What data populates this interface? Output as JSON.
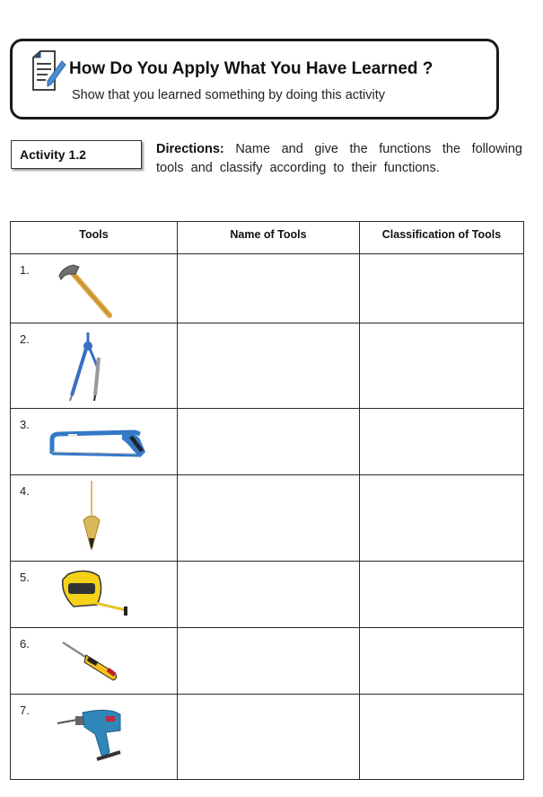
{
  "header": {
    "icon": "document-pencil-icon",
    "title": "How Do You Apply What You Have Learned ?",
    "subtitle": "Show that you learned something by doing this activity"
  },
  "activity": {
    "label": "Activity 1.2",
    "directions_label": "Directions:",
    "directions_text": "Name and give the functions the following tools  and classify according to their functions."
  },
  "table": {
    "columns": [
      "Tools",
      "Name of Tools",
      "Classification of Tools"
    ],
    "rows": [
      {
        "number": "1.",
        "tool_icon": "claw-hammer-icon",
        "name": "",
        "classification": ""
      },
      {
        "number": "2.",
        "tool_icon": "drawing-compass-icon",
        "name": "",
        "classification": ""
      },
      {
        "number": "3.",
        "tool_icon": "hacksaw-icon",
        "name": "",
        "classification": ""
      },
      {
        "number": "4.",
        "tool_icon": "plumb-bob-icon",
        "name": "",
        "classification": ""
      },
      {
        "number": "5.",
        "tool_icon": "tape-measure-icon",
        "name": "",
        "classification": ""
      },
      {
        "number": "6.",
        "tool_icon": "screwdriver-icon",
        "name": "",
        "classification": ""
      },
      {
        "number": "7.",
        "tool_icon": "electric-drill-icon",
        "name": "",
        "classification": ""
      }
    ]
  }
}
